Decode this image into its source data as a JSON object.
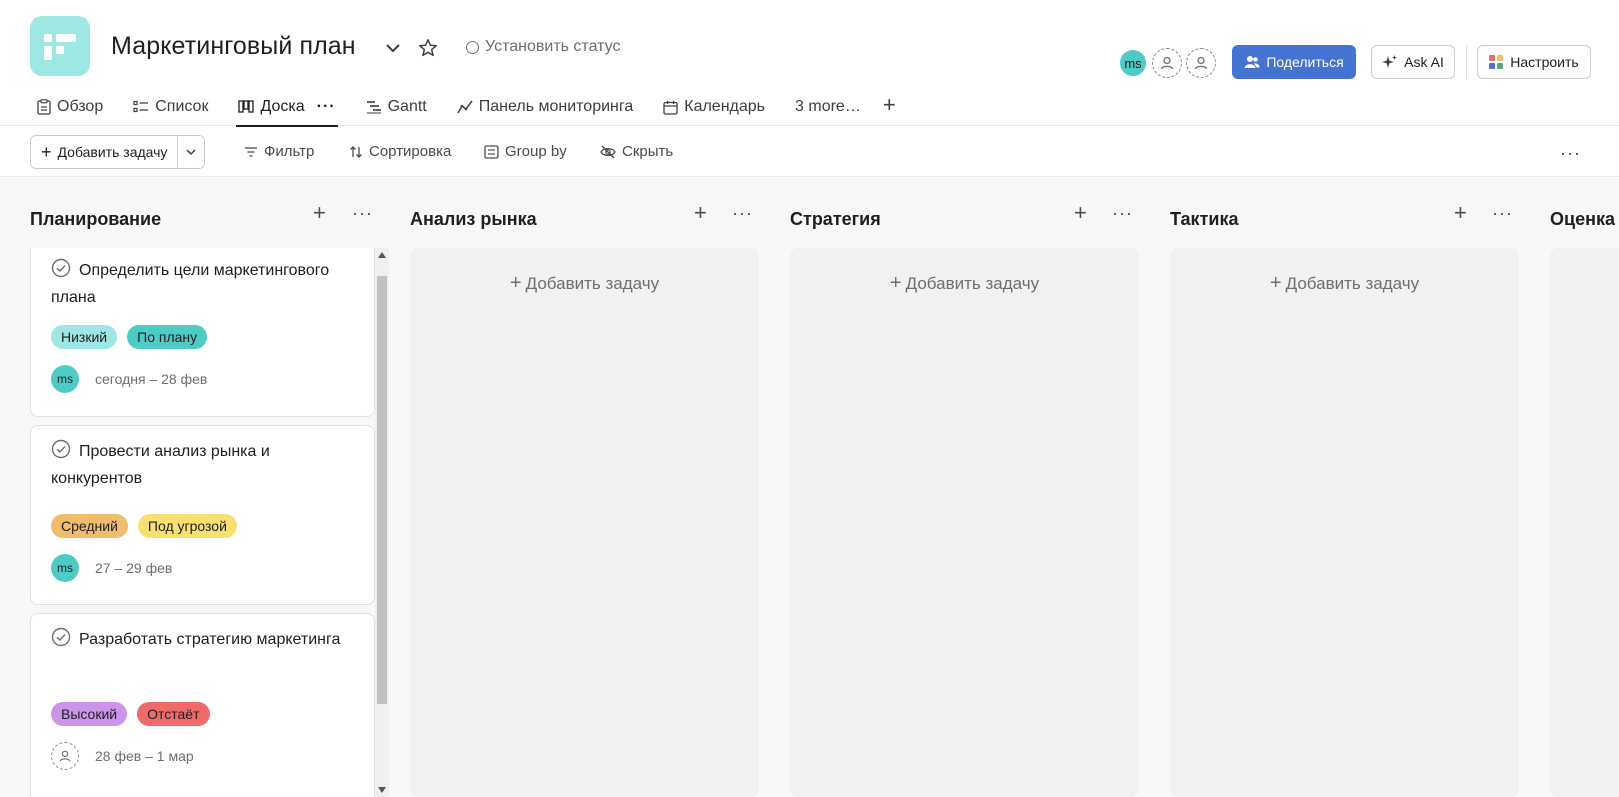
{
  "project": {
    "title": "Маркетинговый план",
    "status_label": "Установить статус"
  },
  "header": {
    "avatar_initials": "ms",
    "share_label": "Поделиться",
    "ask_ai_label": "Ask AI",
    "customize_label": "Настроить"
  },
  "tabs": [
    {
      "label": "Обзор",
      "icon": "overview-icon"
    },
    {
      "label": "Список",
      "icon": "list-icon"
    },
    {
      "label": "Доска",
      "icon": "board-icon",
      "active": true,
      "more": "···"
    },
    {
      "label": "Gantt",
      "icon": "gantt-icon"
    },
    {
      "label": "Панель мониторинга",
      "icon": "dashboard-icon"
    },
    {
      "label": "Календарь",
      "icon": "calendar-icon"
    },
    {
      "label": "3 more…",
      "icon": ""
    }
  ],
  "toolbar": {
    "add_task_label": "Добавить задачу",
    "filter_label": "Фильтр",
    "sort_label": "Сортировка",
    "group_by_label": "Group by",
    "hide_label": "Скрыть"
  },
  "columns": [
    {
      "title": "Планирование"
    },
    {
      "title": "Анализ рынка",
      "add_label": "Добавить задачу"
    },
    {
      "title": "Стратегия",
      "add_label": "Добавить задачу"
    },
    {
      "title": "Тактика",
      "add_label": "Добавить задачу"
    },
    {
      "title": "Оценка"
    }
  ],
  "cards": [
    {
      "title": "Определить цели маркетингового плана",
      "priority": {
        "label": "Низкий",
        "color": "#9ee7e3"
      },
      "status": {
        "label": "По плану",
        "color": "#4ecbc4"
      },
      "assignee": "ms",
      "date": "сегодня – 28 фев"
    },
    {
      "title": "Провести анализ рынка и конкурентов",
      "priority": {
        "label": "Средний",
        "color": "#f1bd6c"
      },
      "status": {
        "label": "Под угрозой",
        "color": "#f8df72"
      },
      "assignee": "ms",
      "date": "27 – 29 фев"
    },
    {
      "title": "Разработать стратегию маркетинга",
      "priority": {
        "label": "Высокий",
        "color": "#cd95ea"
      },
      "status": {
        "label": "Отстаёт",
        "color": "#f06a6a"
      },
      "assignee": "",
      "date": "28 фев – 1 мар"
    }
  ],
  "colors": {
    "accent_blue": "#4573d2",
    "project_icon": "#9ee7e3",
    "avatar": "#4ecbc4"
  }
}
